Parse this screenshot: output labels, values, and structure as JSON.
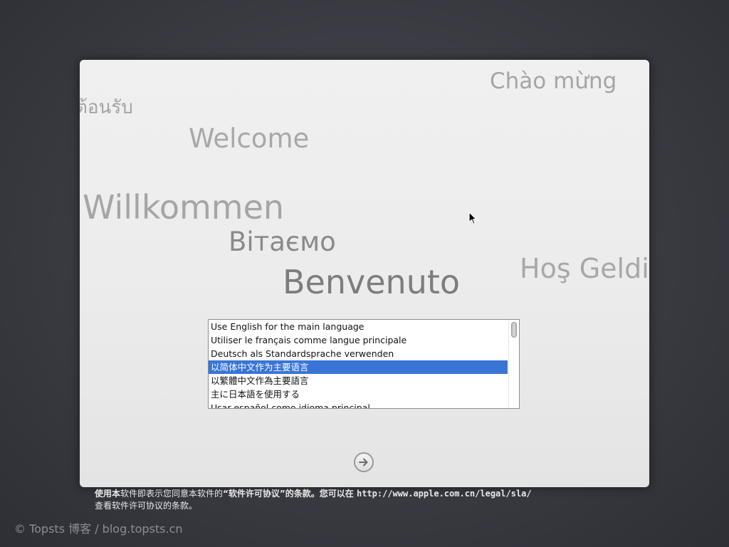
{
  "greetings": {
    "thai_partial_1": "ı",
    "thai_partial_2": "ี่ต้อนรับ",
    "welcome": "Welcome",
    "willkommen": "Willkommen",
    "vitaemo": "Вітаємо",
    "benvenuto": "Benvenuto",
    "chao_mung": "Chào mừng",
    "hos_geldi": "Hoş Geldi"
  },
  "language_list": {
    "items": [
      {
        "label": "Use English for the main language",
        "selected": false
      },
      {
        "label": "Utiliser le français comme langue principale",
        "selected": false
      },
      {
        "label": "Deutsch als Standardsprache verwenden",
        "selected": false
      },
      {
        "label": "以简体中文作为主要语言",
        "selected": true
      },
      {
        "label": "以繁體中文作為主要語言",
        "selected": false
      },
      {
        "label": "主に日本語を使用する",
        "selected": false
      },
      {
        "label": "Usar español como idioma principal",
        "selected": false
      }
    ]
  },
  "next_button": {
    "icon": "arrow-right-icon"
  },
  "license": {
    "part1_bold": "使用本",
    "part2": "软件即表示您同意本软件的",
    "part3_bold": "“软件许可协议”的条款。您可以在 ",
    "url": "http://www.apple.com.cn/legal/sla/",
    "line2": "查看软件许可协议的条款。"
  },
  "watermark": "© Topsts 博客 / blog.topsts.cn",
  "colors": {
    "selection": "#3875d7",
    "background": "#3a3b42",
    "panel": "#ececec"
  }
}
